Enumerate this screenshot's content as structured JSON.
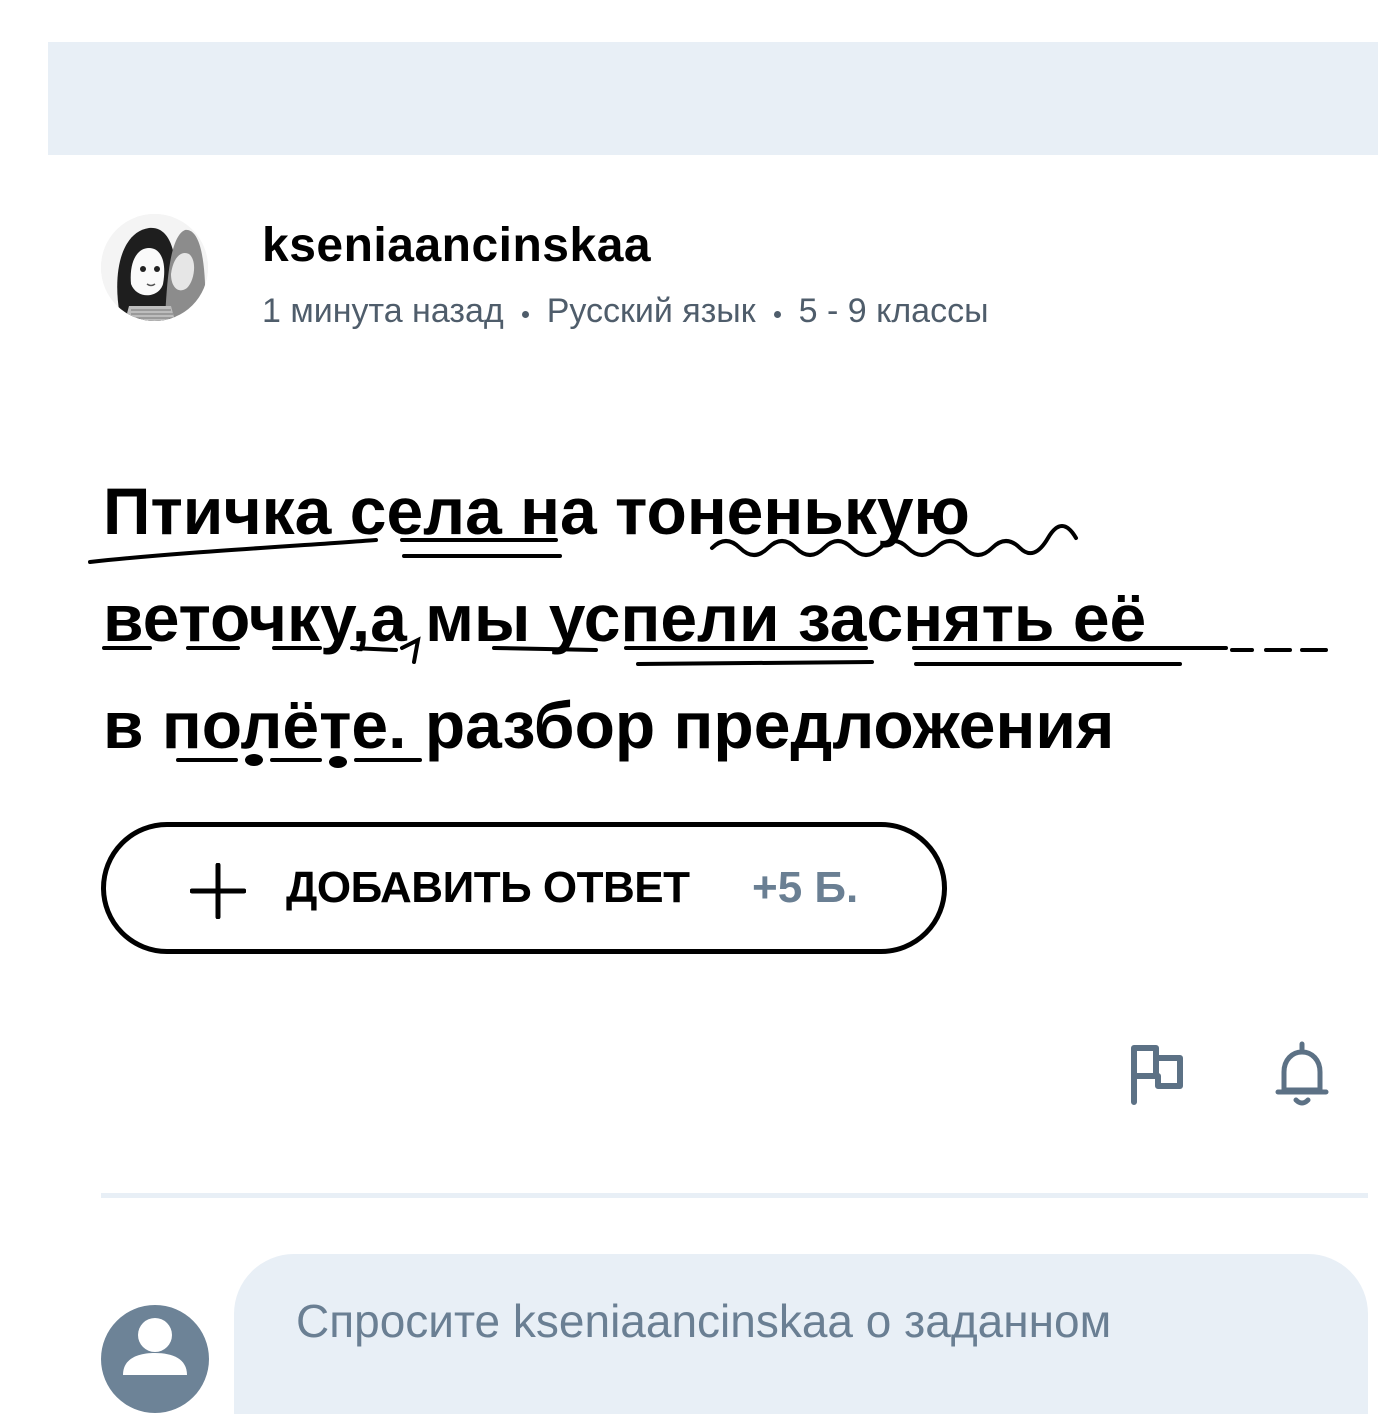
{
  "question": {
    "author": "kseniaancinskaa",
    "time": "1 минута назад",
    "subject": "Русский язык",
    "grade": "5 - 9 классы",
    "lines": [
      [
        "Птичка",
        "села",
        "на",
        "тоненькую"
      ],
      [
        "веточку,",
        "а",
        "мы",
        "успели",
        "заснять",
        "её"
      ],
      [
        "в",
        "полёте.",
        "разбор",
        "предложения"
      ]
    ]
  },
  "actions": {
    "add_answer_label": "ДОБАВИТЬ ОТВЕТ",
    "add_answer_points": "+5 Б.",
    "report_icon": "flag-icon",
    "follow_icon": "bell-icon"
  },
  "comment": {
    "placeholder": "Спросите kseniaancinskaa о заданном"
  },
  "colors": {
    "banner_bg": "#e8eff6",
    "muted_text": "#4f5d6b",
    "accent_gray": "#6a7f93"
  }
}
